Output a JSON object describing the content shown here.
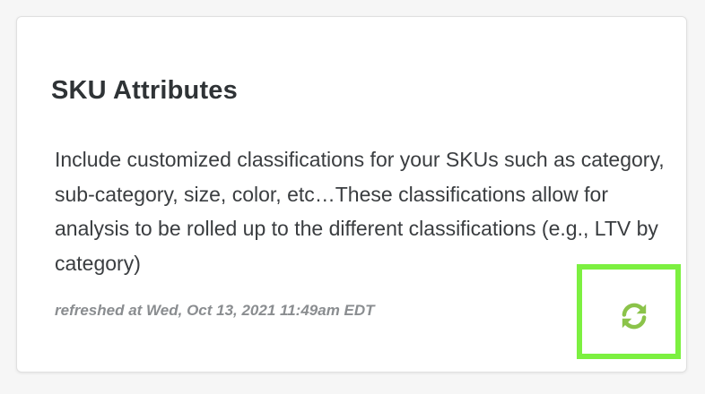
{
  "card": {
    "title": "SKU Attributes",
    "description": "Include customized classifications for your SKUs such as category, sub-category, size, color, etc…These classifications allow for analysis to be rolled up to the different classifications (e.g., LTV by category)",
    "refreshed_text": "refreshed at Wed, Oct 13, 2021 11:49am EDT",
    "refresh_icon": "refresh-icon"
  },
  "colors": {
    "refresh_icon": "#8bc34a",
    "highlight": "#7cf040"
  }
}
